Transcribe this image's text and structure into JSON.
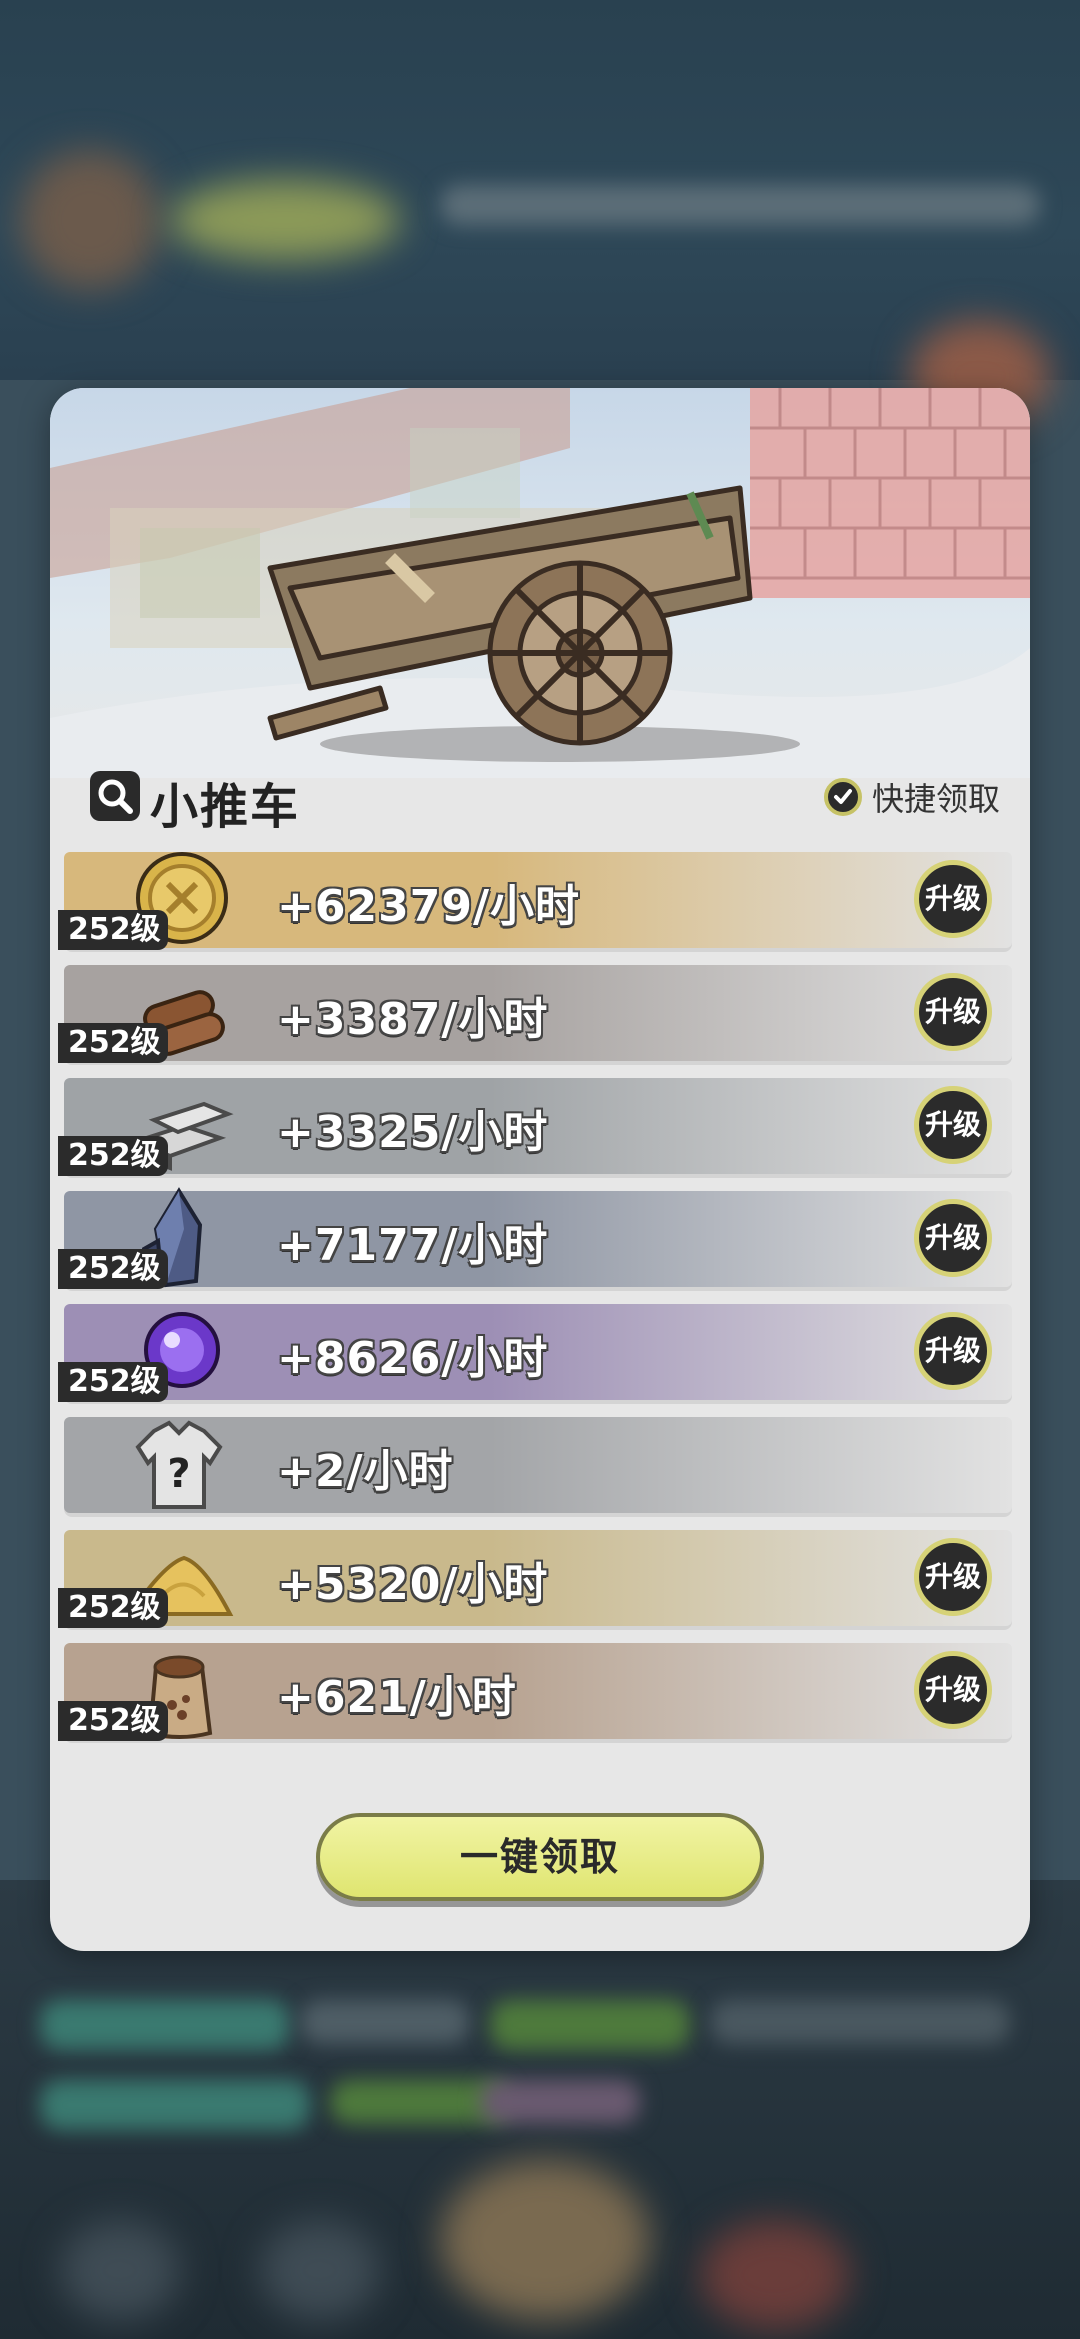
{
  "dialog": {
    "title": "小推车",
    "quick_claim_label": "快捷领取",
    "claim_all_label": "一键领取",
    "upgrade_label": "升级"
  },
  "resources": [
    {
      "name": "gold-coin",
      "level": "252级",
      "rate": "+62379/小时",
      "upgradable": true,
      "color": "#d7b87c"
    },
    {
      "name": "wood",
      "level": "252级",
      "rate": "+3387/小时",
      "upgradable": true,
      "color": "#a7a2a0"
    },
    {
      "name": "iron-ingot",
      "level": "252级",
      "rate": "+3325/小时",
      "upgradable": true,
      "color": "#9fa3a6"
    },
    {
      "name": "crystal-ore",
      "level": "252级",
      "rate": "+7177/小时",
      "upgradable": true,
      "color": "#8f96a4"
    },
    {
      "name": "magic-orb",
      "level": "252级",
      "rate": "+8626/小时",
      "upgradable": true,
      "color": "#9d8fb5"
    },
    {
      "name": "mystery-armor",
      "level": "",
      "rate": "+2/小时",
      "upgradable": false,
      "color": "#a3a5a8"
    },
    {
      "name": "sand-pile",
      "level": "252级",
      "rate": "+5320/小时",
      "upgradable": true,
      "color": "#c9b98c"
    },
    {
      "name": "grain-sack",
      "level": "252级",
      "rate": "+621/小时",
      "upgradable": true,
      "color": "#b7a290"
    }
  ]
}
